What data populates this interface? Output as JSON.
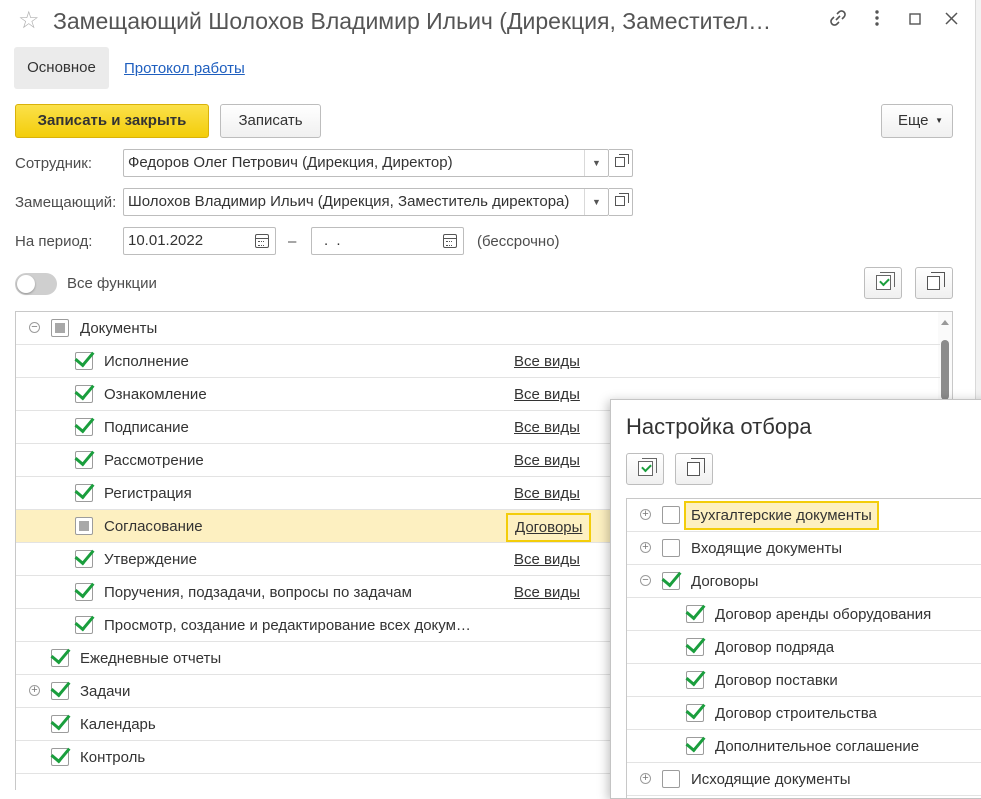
{
  "window": {
    "title": "Замещающий Шолохов Владимир Ильич (Дирекция, Заместител…",
    "icons": [
      "star-icon",
      "link-icon",
      "more-icon",
      "maximize-icon",
      "close-icon"
    ]
  },
  "tabs": [
    {
      "label": "Основное",
      "active": true
    },
    {
      "label": "Протокол работы",
      "active": false
    }
  ],
  "toolbar": {
    "save_close_label": "Записать и закрыть",
    "save_label": "Записать",
    "more_label": "Еще"
  },
  "form": {
    "employee_label": "Сотрудник:",
    "employee_value": "Федоров Олег Петрович (Дирекция, Директор)",
    "substitute_label": "Замещающий:",
    "substitute_value": "Шолохов Владимир Ильич (Дирекция, Заместитель директора)",
    "period_label": "На период:",
    "period_from": "10.01.2022",
    "period_dash": "–",
    "period_to": " .  . ",
    "period_note": "(бессрочно)"
  },
  "functions": {
    "toggle_label": "Все функции",
    "toggle_on": false
  },
  "tree": {
    "rows": [
      {
        "label": "Документы",
        "level": 0,
        "expander": "minus",
        "check": "partial",
        "kinds": ""
      },
      {
        "label": "Исполнение",
        "level": 1,
        "expander": "",
        "check": "on",
        "kinds": "Все виды"
      },
      {
        "label": "Ознакомление",
        "level": 1,
        "expander": "",
        "check": "on",
        "kinds": "Все виды"
      },
      {
        "label": "Подписание",
        "level": 1,
        "expander": "",
        "check": "on",
        "kinds": "Все виды"
      },
      {
        "label": "Рассмотрение",
        "level": 1,
        "expander": "",
        "check": "on",
        "kinds": "Все виды"
      },
      {
        "label": "Регистрация",
        "level": 1,
        "expander": "",
        "check": "on",
        "kinds": "Все виды"
      },
      {
        "label": "Согласование",
        "level": 1,
        "expander": "",
        "check": "partial",
        "kinds": "Договоры",
        "selected": true
      },
      {
        "label": "Утверждение",
        "level": 1,
        "expander": "",
        "check": "on",
        "kinds": "Все виды"
      },
      {
        "label": "Поручения, подзадачи, вопросы по задачам",
        "level": 1,
        "expander": "",
        "check": "on",
        "kinds": "Все виды"
      },
      {
        "label": "Просмотр, создание и редактирование всех докум…",
        "level": 1,
        "expander": "",
        "check": "on",
        "kinds": ""
      },
      {
        "label": "Ежедневные отчеты",
        "level": 0,
        "expander": "",
        "check": "on",
        "kinds": ""
      },
      {
        "label": "Задачи",
        "level": 0,
        "expander": "plus",
        "check": "on",
        "kinds": ""
      },
      {
        "label": "Календарь",
        "level": 0,
        "expander": "",
        "check": "on",
        "kinds": ""
      },
      {
        "label": "Контроль",
        "level": 0,
        "expander": "",
        "check": "on",
        "kinds": ""
      }
    ]
  },
  "popup": {
    "title": "Настройка отбора",
    "rows": [
      {
        "label": "Бухгалтерские документы",
        "level": 0,
        "expander": "plus",
        "check": "off",
        "focused": true
      },
      {
        "label": "Входящие документы",
        "level": 0,
        "expander": "plus",
        "check": "off"
      },
      {
        "label": "Договоры",
        "level": 0,
        "expander": "minus",
        "check": "on"
      },
      {
        "label": "Договор аренды оборудования",
        "level": 1,
        "expander": "",
        "check": "on"
      },
      {
        "label": "Договор подряда",
        "level": 1,
        "expander": "",
        "check": "on"
      },
      {
        "label": "Договор поставки",
        "level": 1,
        "expander": "",
        "check": "on"
      },
      {
        "label": "Договор строительства",
        "level": 1,
        "expander": "",
        "check": "on"
      },
      {
        "label": "Дополнительное соглашение",
        "level": 1,
        "expander": "",
        "check": "on"
      },
      {
        "label": "Исходящие документы",
        "level": 0,
        "expander": "plus",
        "check": "off"
      }
    ]
  },
  "colors": {
    "accent_yellow": "#f3cd0a",
    "check_green": "#1a9e3d",
    "link_blue": "#1f5fbf",
    "selection": "#fdf0c1"
  }
}
